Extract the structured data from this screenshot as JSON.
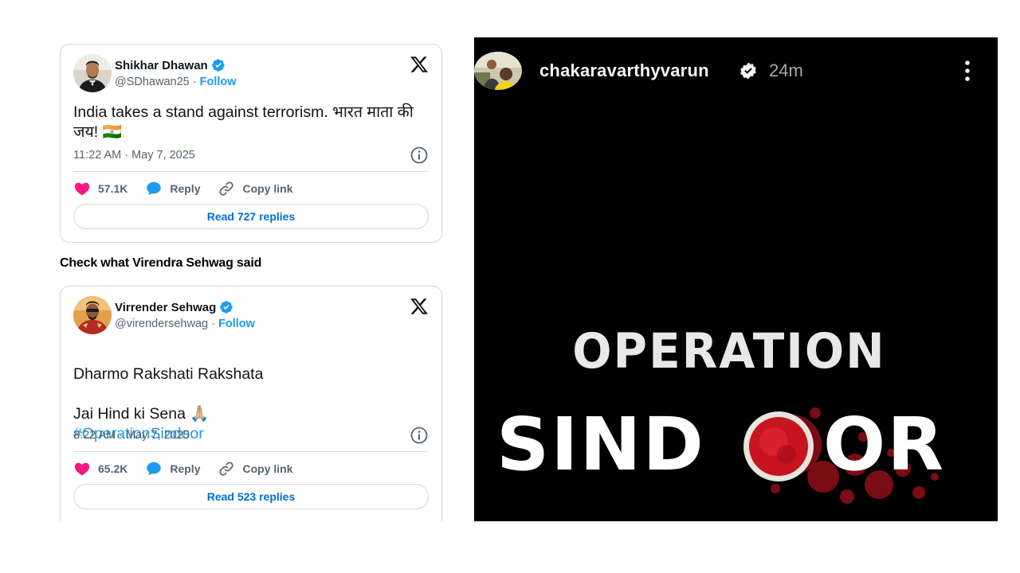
{
  "tweets": [
    {
      "author": "Shikhar Dhawan",
      "handle": "@SDhawan25",
      "separator": "·",
      "follow_label": "Follow",
      "text": "India takes a stand against terrorism. भारत माता की जय! 🇮🇳",
      "hashtag": "",
      "timestamp": "11:22 AM · May 7, 2025",
      "likes": "57.1K",
      "reply_label": "Reply",
      "copy_link_label": "Copy link",
      "read_replies_label": "Read 727 replies"
    },
    {
      "author": "Virrender Sehwag",
      "handle": "@virendersehwag",
      "separator": "·",
      "follow_label": "Follow",
      "text": "Dharmo Rakshati Rakshata\n\nJai Hind ki Sena 🙏🏼",
      "hashtag": "#OperationSindoor",
      "timestamp": "8:22 AM · May 7, 2025",
      "likes": "65.2K",
      "reply_label": "Reply",
      "copy_link_label": "Copy link",
      "read_replies_label": "Read 523 replies"
    }
  ],
  "section_heading": "Check what Virendra Sehwag said",
  "story": {
    "username": "chakaravarthyvarun",
    "time_ago": "24m",
    "poster_line1": "OPERATION",
    "poster_line2_left": "SIND",
    "poster_line2_right": "OR"
  },
  "colors": {
    "like": "#f91880",
    "reply": "#1d9bf0",
    "verified": "#1d9bf0",
    "link": "#006fd6",
    "sindoor_red": "#c8141e"
  },
  "icons": [
    "verified-badge-icon",
    "x-logo-icon",
    "info-icon",
    "heart-icon",
    "reply-bubble-icon",
    "link-icon",
    "more-vertical-icon"
  ]
}
